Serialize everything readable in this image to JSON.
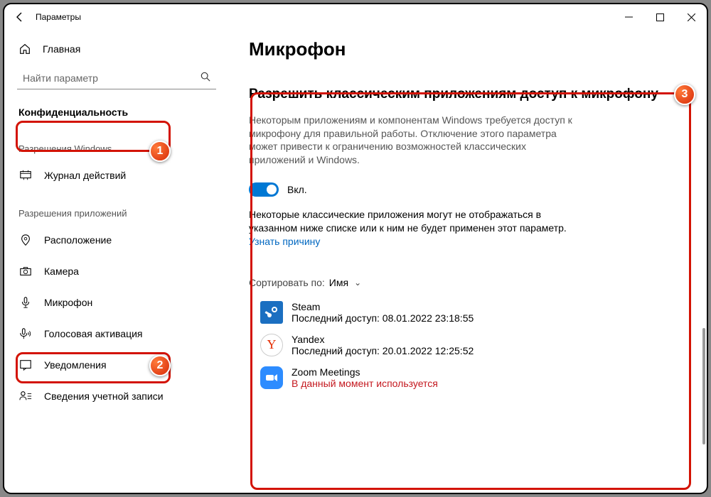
{
  "window": {
    "title": "Параметры"
  },
  "sidebar": {
    "home": "Главная",
    "search_placeholder": "Найти параметр",
    "category": "Конфиденциальность",
    "section_windows": "Разрешения Windows",
    "item_activity": "Журнал действий",
    "section_apps": "Разрешения приложений",
    "item_location": "Расположение",
    "item_camera": "Камера",
    "item_microphone": "Микрофон",
    "item_voice": "Голосовая активация",
    "item_notifications": "Уведомления",
    "item_account": "Сведения учетной записи"
  },
  "main": {
    "h1": "Микрофон",
    "h2": "Разрешить классическим приложениям доступ к микрофону",
    "desc": "Некоторым приложениям и компонентам Windows требуется доступ к микрофону для правильной работы. Отключение этого параметра может привести к ограничению возможностей классических приложений и Windows.",
    "toggle_label": "Вкл.",
    "note_text": "Некоторые классические приложения могут не отображаться в указанном ниже списке или к ним не будет применен этот параметр. ",
    "note_link": "Узнать причину",
    "sort_label": "Сортировать по:",
    "sort_value": "Имя",
    "apps": [
      {
        "name": "Steam",
        "status": "Последний доступ: 08.01.2022 23:18:55",
        "inuse": false,
        "icon": "steam"
      },
      {
        "name": "Yandex",
        "status": "Последний доступ: 20.01.2022 12:25:52",
        "inuse": false,
        "icon": "yandex"
      },
      {
        "name": "Zoom Meetings",
        "status": "В данный момент используется",
        "inuse": true,
        "icon": "zoom"
      }
    ]
  },
  "badges": {
    "b1": "1",
    "b2": "2",
    "b3": "3"
  }
}
